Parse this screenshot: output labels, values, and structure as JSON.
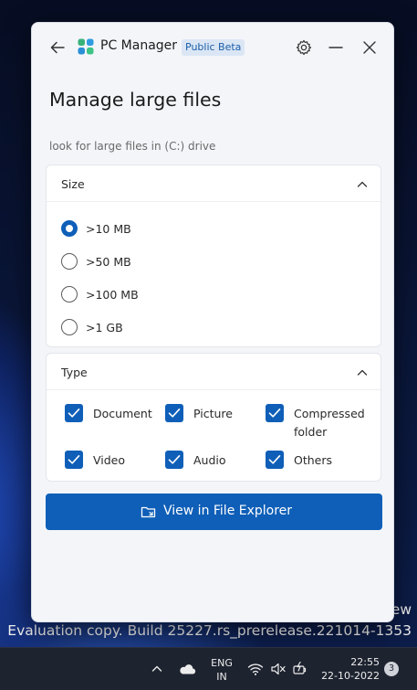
{
  "desktop": {
    "watermark_line1": "ew",
    "watermark_line2": "Evaluation copy. Build 25227.rs_prerelease.221014-1353"
  },
  "window": {
    "app_title": "PC Manager",
    "badge": "Public Beta",
    "icons": {
      "back": "arrow-left-icon",
      "logo": "pc-manager-logo-icon",
      "settings": "gear-icon",
      "minimize": "minimize-icon",
      "close": "close-icon"
    }
  },
  "page": {
    "title": "Manage large files",
    "subtitle": "look for large files in (C:) drive"
  },
  "size_section": {
    "label": "Size",
    "expanded": true,
    "options": [
      {
        "label": ">10 MB",
        "checked": true
      },
      {
        "label": ">50 MB",
        "checked": false
      },
      {
        "label": ">100 MB",
        "checked": false
      },
      {
        "label": ">1 GB",
        "checked": false
      }
    ]
  },
  "type_section": {
    "label": "Type",
    "expanded": true,
    "options": [
      {
        "label": "Document",
        "checked": true
      },
      {
        "label": "Picture",
        "checked": true
      },
      {
        "label": "Compressed folder",
        "checked": true
      },
      {
        "label": "Video",
        "checked": true
      },
      {
        "label": "Audio",
        "checked": true
      },
      {
        "label": "Others",
        "checked": true
      }
    ]
  },
  "primary_action": {
    "label": "View in File Explorer",
    "icon": "file-explorer-icon"
  },
  "taskbar": {
    "lang_line1": "ENG",
    "lang_line2": "IN",
    "time": "22:55",
    "date": "22-10-2022",
    "notification_count": "3",
    "icons": [
      "chevron-up-icon",
      "onedrive-cloud-icon",
      "wifi-icon",
      "volume-muted-icon",
      "battery-charging-icon"
    ]
  },
  "colors": {
    "accent": "#0f5fb8",
    "window_bg": "#f3f5f9",
    "badge_bg": "#dbe6f5",
    "badge_text": "#1a5ea8"
  }
}
